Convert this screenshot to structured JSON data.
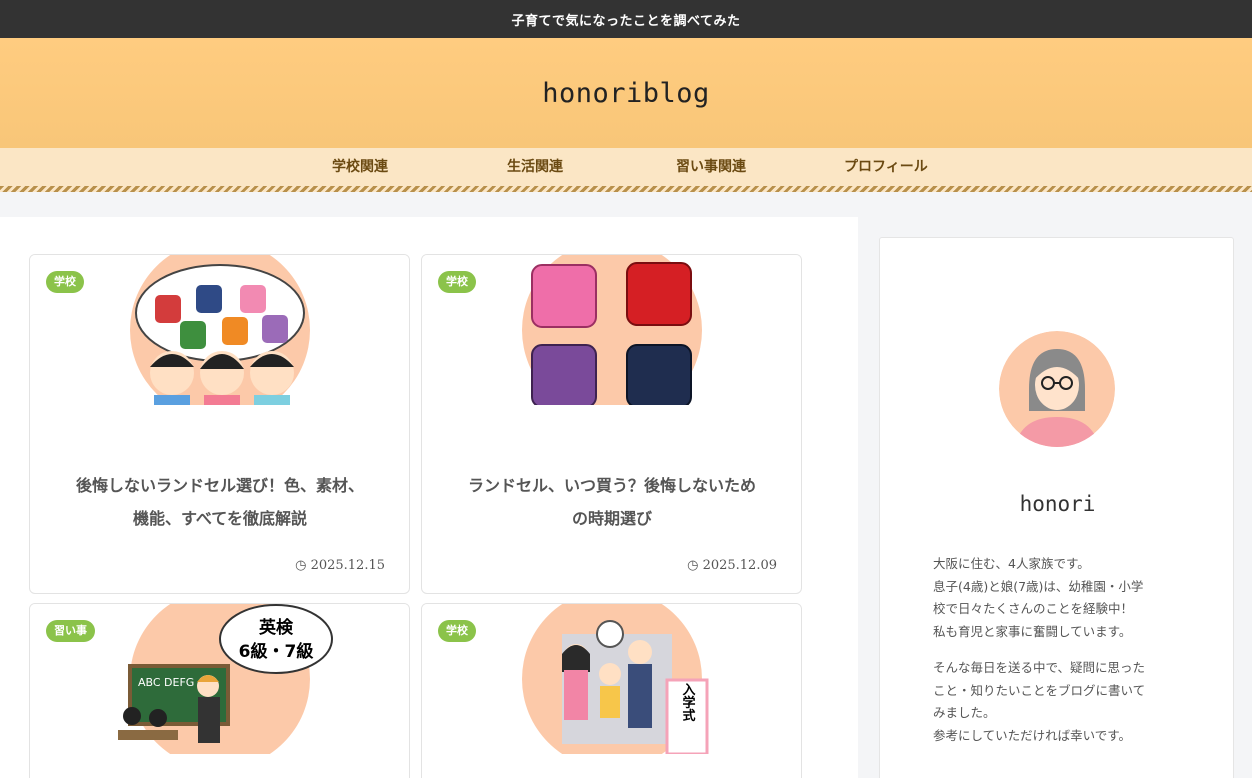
{
  "topbar": {
    "text": "子育てで気になったことを調べてみた"
  },
  "header": {
    "site_title": "honoriblog"
  },
  "nav": {
    "items": [
      "学校関連",
      "生活関連",
      "習い事関連",
      "プロフィール"
    ]
  },
  "cards": [
    {
      "badge": "学校",
      "title_line1": "後悔しないランドセル選び！色、素材、",
      "title_line2": "機能、すべてを徹底解説",
      "date": "2025.12.15",
      "thumb_icon": "school-bags-children-illustration"
    },
    {
      "badge": "学校",
      "title_line1": "ランドセル、いつ買う？後悔しないため",
      "title_line2": "の時期選び",
      "date": "2025.12.09",
      "thumb_icon": "randoseru-bags-illustration"
    },
    {
      "badge": "習い事",
      "thumb_text_line1": "英検",
      "thumb_text_line2": "6級・7級",
      "thumb_board": "ABC DEFG",
      "thumb_icon": "english-class-illustration"
    },
    {
      "badge": "学校",
      "thumb_text": "入学式",
      "thumb_icon": "entrance-ceremony-illustration"
    }
  ],
  "sidebar": {
    "name": "honori",
    "bio1": [
      "大阪に住む、4人家族です。",
      "息子(4歳)と娘(7歳)は、幼稚園・小学",
      "校で日々たくさんのことを経験中！",
      "私も育児と家事に奮闘しています。"
    ],
    "bio2": [
      "そんな毎日を送る中で、疑問に思った",
      "こと・知りたいことをブログに書いて",
      "みました。",
      "参考にしていただければ幸いです。"
    ]
  },
  "colors": {
    "topbar": "#333333",
    "header": "#ffcc80",
    "nav": "#fbe6c5",
    "nav_text": "#6b4a12",
    "badge": "#8bc34a",
    "thumb_circle": "#fcc9a9"
  }
}
